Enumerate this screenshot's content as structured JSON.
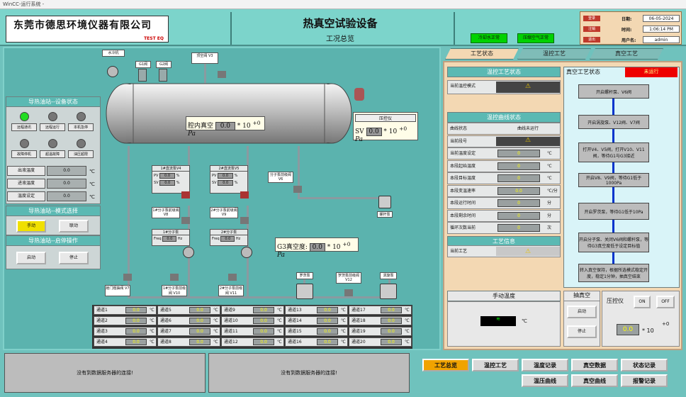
{
  "window": {
    "title": "WinCC-运行系统 - "
  },
  "header": {
    "company": "东莞市德思环境仪器有限公司",
    "brand": "TEST EQ",
    "title": "热真空试验设备",
    "subtitle": "工况总览",
    "status1": "冷却水正常",
    "status2": "压缩空气正常",
    "info": {
      "btn1": "登录",
      "btn2": "注销",
      "btn3": "退出",
      "date_label": "日期:",
      "date": "06-05-2024",
      "time_label": "时间:",
      "time": "1:06:14 PM",
      "user_label": "用户名:",
      "user": "admin"
    }
  },
  "equipment": {
    "chiller": "水冷机",
    "g1": "G1阀",
    "g2": "G2阀",
    "v3": "顶空阀 V3",
    "screen": "腔内真空",
    "screen_val": "0.0",
    "pow": "+0",
    "pa": "Pa",
    "mult": "* 10",
    "pressure_title": "压控仪",
    "sv": "SV",
    "sv_val": "0.0",
    "v4": "1#直流泵V4",
    "v5": "2#直流泵V5",
    "pv": "PV",
    "sv2": "SV",
    "pct": "%",
    "v6": "分子泵前级阀 V6",
    "screw": "螺杆泵",
    "m1": "1#分子泵前级阀 V8",
    "m2": "2#分子泵前级阀 V9",
    "mp1": "1#分子泵",
    "mp2": "2#分子泵",
    "freq": "Freq",
    "hz": "Hz",
    "v_val": "0.0",
    "g3": "G3真空度:",
    "g3_val": "0.0",
    "roots": "罗茨泵",
    "v12": "罗茨泵前级阀 V12",
    "scroll": "涡旋泵",
    "v7": "舱门粗抽阀 V7",
    "v10": "1#分子泵前级阀 V10",
    "v11": "2#分子泵前级阀 V11"
  },
  "oil": {
    "status_title": "导热油站--设备状态",
    "lamps": [
      "远程通讯",
      "远程运行",
      "本机急停",
      "故障停机",
      "超温故障",
      "油压超限"
    ],
    "rows": [
      {
        "l": "出液温度",
        "v": "0.0",
        "u": "℃"
      },
      {
        "l": "进液温度",
        "v": "0.0",
        "u": "℃"
      },
      {
        "l": "温度设定",
        "v": "0.0",
        "u": "℃"
      }
    ],
    "mode_title": "导热油站--模式选择",
    "mode_auto": "手动",
    "mode_man": "联动",
    "op_title": "导热油站--启停操作",
    "start": "启动",
    "stop": "停止"
  },
  "channels": [
    "通道1",
    "通道2",
    "通道3",
    "通道4",
    "通道5",
    "通道6",
    "通道7",
    "通道8",
    "通道9",
    "通道10",
    "通道11",
    "通道12",
    "通道13",
    "通道14",
    "通道15",
    "通道16",
    "通道17",
    "通道18",
    "通道19",
    "通道20"
  ],
  "ch_val": "0.0",
  "ch_unit": "℃",
  "messages": [
    "没有到数据服务器的连接!",
    "没有到数据服务器的连接!"
  ],
  "right": {
    "tabs": [
      "工艺状态",
      "温控工艺",
      "真空工艺"
    ],
    "temp_state": "温控工艺状态",
    "temp_mode": "当前温控模式",
    "curve_state": "温控曲线状态",
    "curve_rows": [
      {
        "l": "曲线状态",
        "v": "曲线未运行",
        "u": ""
      },
      {
        "l": "当前段号",
        "v": "",
        "u": ""
      },
      {
        "l": "当前温度设定",
        "v": "0",
        "u": "℃"
      },
      {
        "l": "本段起始温度",
        "v": "0",
        "u": "℃"
      },
      {
        "l": "本段目标温度",
        "v": "0",
        "u": "℃"
      },
      {
        "l": "本段变温速率",
        "v": "0.0",
        "u": "℃/分"
      },
      {
        "l": "本段运行时间",
        "v": "0",
        "u": "分"
      },
      {
        "l": "本段剩余时间",
        "v": "0",
        "u": "分"
      },
      {
        "l": "循环次数当前",
        "v": "0",
        "u": "次"
      }
    ],
    "proc_info": "工艺信息",
    "proc_cur": "当前工艺",
    "vac_state": "真空工艺状态",
    "vac_badge": "未运行",
    "steps": [
      "开启螺杆泵、V6阀",
      "开启涡旋泵、V12阀、V7阀",
      "打开V4、V5阀，打开V10、V11阀，等待G1与G3接近",
      "开启V8、V9阀，等待G1低于1000Pa",
      "开启罗茨泵，等待G1低于10Pa",
      "开启分子泵、关闭V6阀和螺杆泵，等待G3真空度低于设定目标值",
      "转入真空保持，根据所选模式稳定开度，稳定1分钟，抽真空结束"
    ],
    "manual_temp": "手动温度",
    "manual_unit": "℃",
    "pump_title": "抽真空",
    "pump_start": "启动",
    "pump_stop": "停止",
    "pc_title": "压控仪",
    "on": "ON",
    "off": "OFF",
    "pc_val": "0.0",
    "pc_pow": "+0",
    "pc_mult": "* 10"
  },
  "nav": [
    "工艺总览",
    "温控工艺",
    "温度记录",
    "真空数据",
    "状态记录",
    "温压曲线",
    "真空曲线",
    "报警记录"
  ]
}
